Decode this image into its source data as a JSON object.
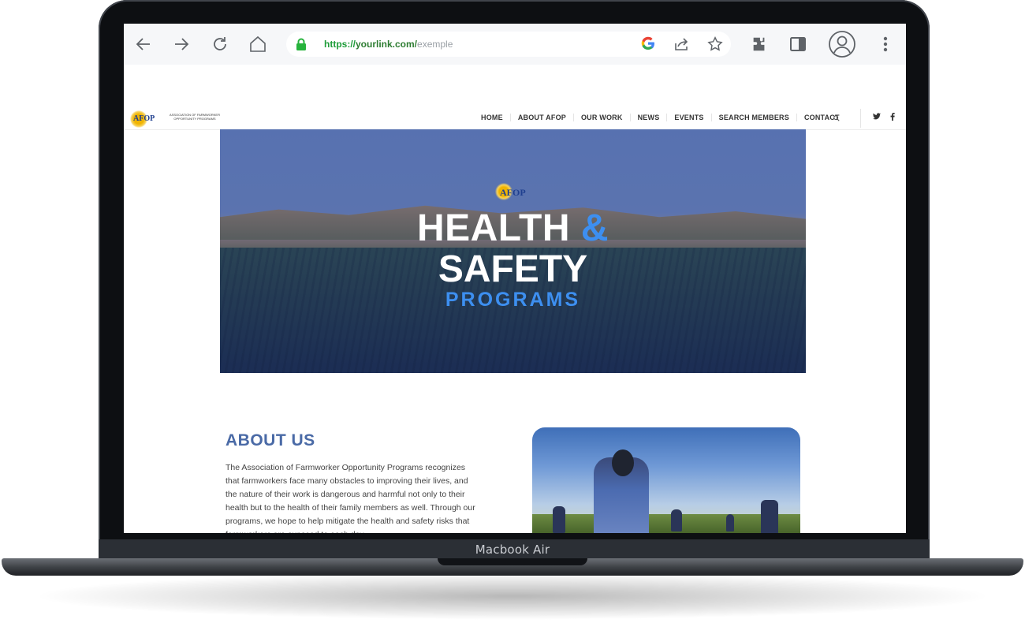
{
  "device": {
    "label": "Macbook Air"
  },
  "browser": {
    "url_scheme": "https://",
    "url_host": "yourlink.com/",
    "url_path": "exemple",
    "icons": [
      "back-arrow-icon",
      "forward-arrow-icon",
      "reload-icon",
      "home-icon",
      "lock-icon",
      "google-icon",
      "share-icon",
      "star-icon",
      "extensions-icon",
      "sidebar-icon",
      "profile-icon",
      "more-vert-icon"
    ]
  },
  "site": {
    "logo": {
      "text": "AFOP",
      "subtitle": "ASSOCIATION OF FARMWORKER OPPORTUNITY PROGRAMS"
    },
    "nav": [
      "HOME",
      "ABOUT AFOP",
      "OUR WORK",
      "NEWS",
      "EVENTS",
      "SEARCH MEMBERS",
      "CONTACT"
    ],
    "social": {
      "twitter": "t",
      "facebook": "f"
    }
  },
  "hero": {
    "logo_text": "AFOP",
    "line1": "HEALTH",
    "line1_amp": "&",
    "line2": "SAFETY",
    "line3": "PROGRAMS",
    "accent_color": "#3d8ff0"
  },
  "about": {
    "title": "ABOUT US",
    "body": "The Association of Farmworker Opportunity Programs recognizes that farmworkers face many obstacles to improving their lives, and the nature of their work is dangerous and harmful not only to their health but to the health of their family members as well.   Through our programs, we hope to help mitigate the health and safety risks that farmworkers are exposed to each day."
  }
}
